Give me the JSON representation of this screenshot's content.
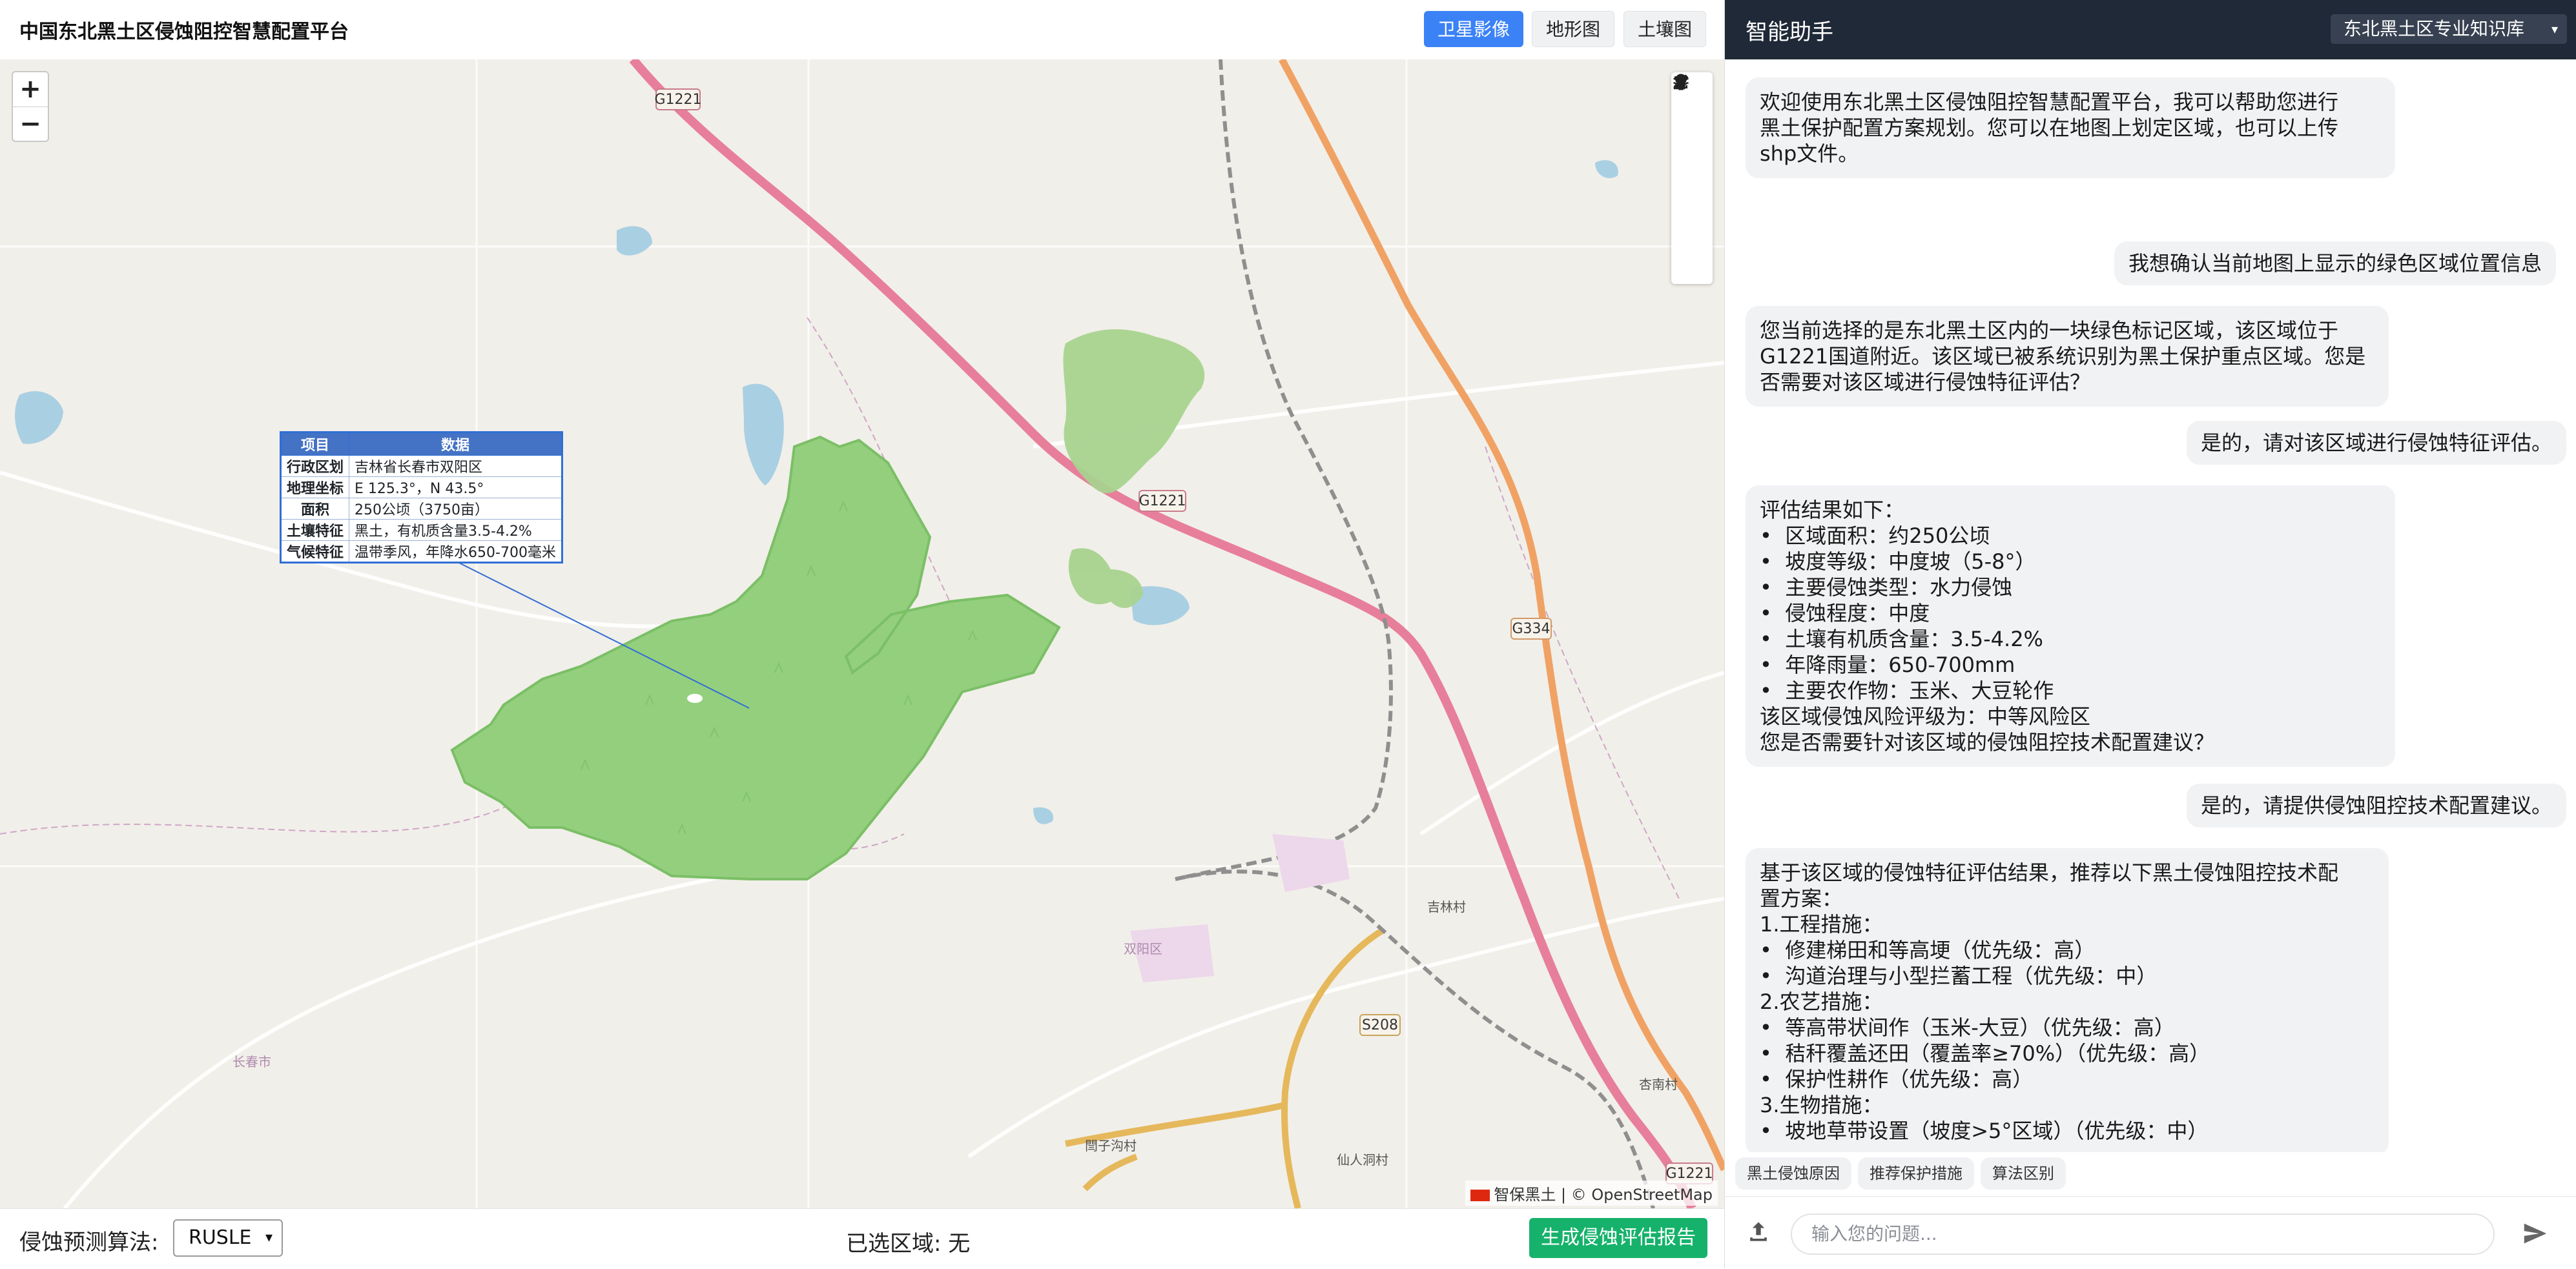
{
  "app": {
    "title": "中国东北黑土区侵蚀阻控智慧配置平台"
  },
  "layers": {
    "satellite": "卫星影像",
    "terrain": "地形图",
    "soil": "土壤图"
  },
  "map": {
    "zoom_in": "+",
    "zoom_out": "−",
    "attribution": "智保黑土 | © OpenStreetMap",
    "road_labels": [
      "G1221",
      "G1221",
      "G1221",
      "G334",
      "S208"
    ],
    "place_labels": [
      "吉林村",
      "杏南村",
      "仙人洞村",
      "閆子沟村",
      "双阳区",
      "长春市"
    ],
    "tools": [
      "pencil-icon",
      "upload-icon",
      "trash-icon",
      "layers-icon",
      "bulb-icon"
    ],
    "info_table": {
      "headers": [
        "项目",
        "数据"
      ],
      "rows": [
        [
          "行政区划",
          "吉林省长春市双阳区"
        ],
        [
          "地理坐标",
          "E 125.3°，N 43.5°"
        ],
        [
          "面积",
          "250公顷（3750亩）"
        ],
        [
          "土壤特征",
          "黑土，有机质含量3.5-4.2%"
        ],
        [
          "气候特征",
          "温带季风，年降水650-700毫米"
        ]
      ]
    }
  },
  "bottom": {
    "algo_label": "侵蚀预测算法:",
    "algo_value": "RUSLE",
    "selected_area": "已选区域: 无",
    "report_button": "生成侵蚀评估报告"
  },
  "assistant": {
    "title": "智能助手",
    "kb": "东北黑土区专业知识库",
    "messages": [
      {
        "role": "bot",
        "text": "欢迎使用东北黑土区侵蚀阻控智慧配置平台，我可以帮助您进行\n黑土保护配置方案规划。您可以在地图上划定区域，也可以上传\nshp文件。"
      },
      {
        "role": "user",
        "text": "我想确认当前地图上显示的绿色区域位置信息"
      },
      {
        "role": "bot",
        "text": "您当前选择的是东北黑土区内的一块绿色标记区域，该区域位于\nG1221国道附近。该区域已被系统识别为黑土保护重点区域。您是\n否需要对该区域进行侵蚀特征评估？"
      },
      {
        "role": "user",
        "text": "是的，请对该区域进行侵蚀特征评估。"
      },
      {
        "role": "bot",
        "text": "评估结果如下：\n•  区域面积：约250公顷\n•  坡度等级：中度坡（5-8°）\n•  主要侵蚀类型：水力侵蚀\n•  侵蚀程度：中度\n•  土壤有机质含量：3.5-4.2%\n•  年降雨量：650-700mm\n•  主要农作物：玉米、大豆轮作\n该区域侵蚀风险评级为：中等风险区\n您是否需要针对该区域的侵蚀阻控技术配置建议？"
      },
      {
        "role": "user",
        "text": "是的，请提供侵蚀阻控技术配置建议。"
      },
      {
        "role": "bot",
        "text": "基于该区域的侵蚀特征评估结果，推荐以下黑土侵蚀阻控技术配\n置方案：\n1.工程措施：\n•  修建梯田和等高埂（优先级：高）\n•  沟道治理与小型拦蓄工程（优先级：中）\n2.农艺措施：\n•  等高带状间作（玉米-大豆）（优先级：高）\n•  秸秆覆盖还田（覆盖率≥70%）（优先级：高）\n•  保护性耕作（优先级：高）\n3.生物措施：\n•  坡地草带设置（坡度>5°区域）（优先级：中）"
      }
    ],
    "quick_actions": [
      "黑土侵蚀原因",
      "推荐保护措施",
      "算法区别"
    ],
    "input_placeholder": "输入您的问题..."
  },
  "colors": {
    "accent": "#3b82f6",
    "report": "#16b26b",
    "header": "#1f2937",
    "region": "#8cc97a"
  }
}
